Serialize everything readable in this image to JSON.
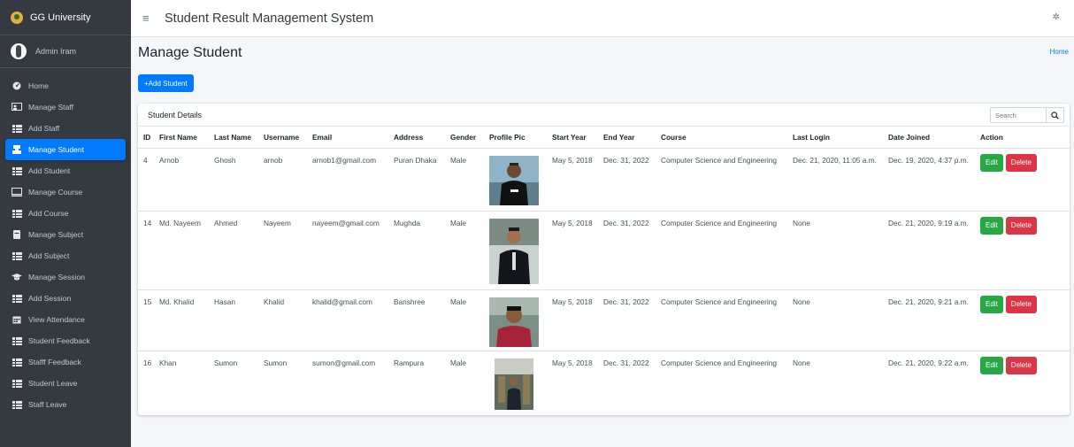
{
  "brand": "GG University",
  "user": "Admin Iram",
  "app_title": "Student Result Management System",
  "sidebar": [
    {
      "label": "Home",
      "icon": "dashboard-icon"
    },
    {
      "label": "Manage Staff",
      "icon": "staff-icon"
    },
    {
      "label": "Add Staff",
      "icon": "grid-icon"
    },
    {
      "label": "Manage Student",
      "icon": "student-icon",
      "active": true
    },
    {
      "label": "Add Student",
      "icon": "grid-icon"
    },
    {
      "label": "Manage Course",
      "icon": "course-icon"
    },
    {
      "label": "Add Course",
      "icon": "grid-icon"
    },
    {
      "label": "Manage Subject",
      "icon": "book-icon"
    },
    {
      "label": "Add Subject",
      "icon": "grid-icon"
    },
    {
      "label": "Manage Session",
      "icon": "graduation-cap-icon"
    },
    {
      "label": "Add Session",
      "icon": "grid-icon"
    },
    {
      "label": "View Attendance",
      "icon": "calendar-icon"
    },
    {
      "label": "Student Feedback",
      "icon": "grid-icon"
    },
    {
      "label": "Stafff Feedback",
      "icon": "grid-icon"
    },
    {
      "label": "Student Leave",
      "icon": "grid-icon"
    },
    {
      "label": "Staff Leave",
      "icon": "grid-icon"
    }
  ],
  "page": {
    "title": "Manage Student",
    "breadcrumb": "Home",
    "add_button": "+Add Student",
    "card_title": "Student Details",
    "search_placeholder": "Search"
  },
  "table": {
    "columns": [
      "ID",
      "First Name",
      "Last Name",
      "Username",
      "Email",
      "Address",
      "Gender",
      "Profile Pic",
      "Start Year",
      "End Year",
      "Course",
      "Last Login",
      "Date Joined",
      "Action"
    ],
    "edit_label": "Edit",
    "delete_label": "Delete",
    "rows": [
      {
        "id": "4",
        "first": "Arnob",
        "last": "Ghosh",
        "username": "arnob",
        "email": "arnob1@gmail.com",
        "address": "Puran Dhaka",
        "gender": "Male",
        "start": "May 5, 2018",
        "end": "Dec. 31, 2022",
        "course": "Computer Science and Engineering",
        "last_login": "Dec. 21, 2020, 11:05 a.m.",
        "joined": "Dec. 19, 2020, 4:37 p.m."
      },
      {
        "id": "14",
        "first": "Md. Nayeem",
        "last": "Ahmed",
        "username": "Nayeem",
        "email": "nayeem@gmail.com",
        "address": "Mughda",
        "gender": "Male",
        "start": "May 5, 2018",
        "end": "Dec. 31, 2022",
        "course": "Computer Science and Engineering",
        "last_login": "None",
        "joined": "Dec. 21, 2020, 9:19 a.m."
      },
      {
        "id": "15",
        "first": "Md. Khalid",
        "last": "Hasan",
        "username": "Khalid",
        "email": "khalid@gmail.com",
        "address": "Banshree",
        "gender": "Male",
        "start": "May 5, 2018",
        "end": "Dec. 31, 2022",
        "course": "Computer Science and Engineering",
        "last_login": "None",
        "joined": "Dec. 21, 2020, 9:21 a.m."
      },
      {
        "id": "16",
        "first": "Khan",
        "last": "Sumon",
        "username": "Sumon",
        "email": "sumon@gmail.com",
        "address": "Rampura",
        "gender": "Male",
        "start": "May 5, 2018",
        "end": "Dec. 31, 2022",
        "course": "Computer Science and Engineering",
        "last_login": "None",
        "joined": "Dec. 21, 2020, 9:22 a.m."
      }
    ]
  },
  "colors": {
    "sidebar": "#343a40",
    "primary": "#007bff",
    "success": "#28a745",
    "danger": "#dc3545"
  }
}
